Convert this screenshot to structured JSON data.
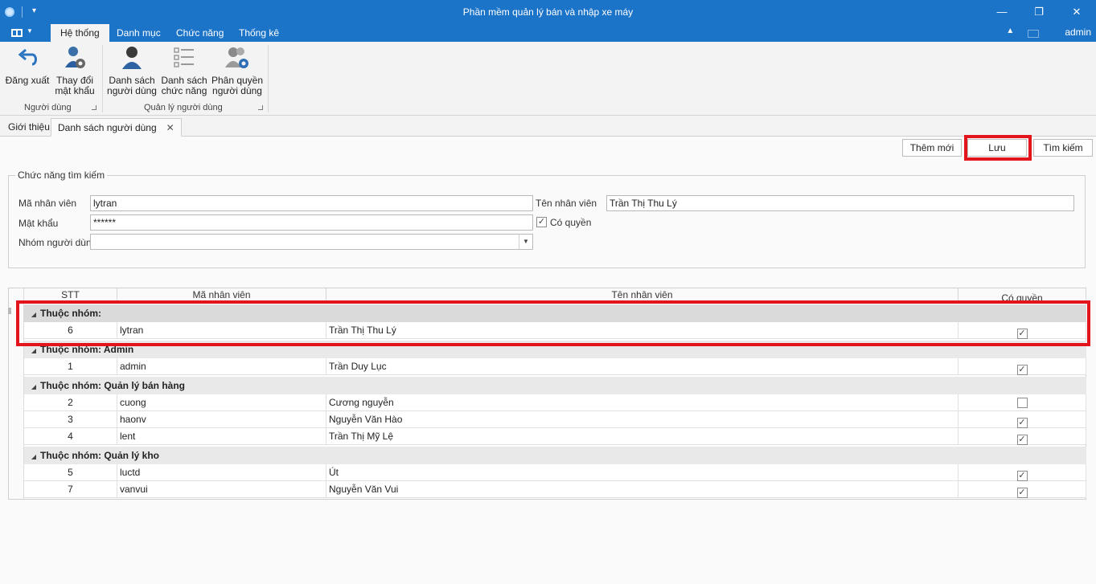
{
  "window": {
    "title": "Phần mềm quản lý bán và nhập xe máy",
    "minimize_glyph": "—",
    "maximize_glyph": "❐",
    "close_glyph": "✕"
  },
  "ribbon": {
    "tabs": [
      "Hệ thống",
      "Danh mục",
      "Chức năng",
      "Thống kê"
    ],
    "active_tab": "Hệ thống",
    "user": "admin",
    "groups": [
      {
        "label": "Người dùng",
        "buttons": [
          {
            "line1": "Đăng xuất",
            "line2": "",
            "icon": "logout-arrow-icon"
          },
          {
            "line1": "Thay đổi",
            "line2": "mật khẩu",
            "icon": "user-gear-icon"
          }
        ]
      },
      {
        "label": "Quản lý người dùng",
        "buttons": [
          {
            "line1": "Danh sách",
            "line2": "người dùng",
            "icon": "user-icon"
          },
          {
            "line1": "Danh sách",
            "line2": "chức năng",
            "icon": "list-icon"
          },
          {
            "line1": "Phân quyền",
            "line2": "người dùng",
            "icon": "users-gear-icon"
          }
        ]
      }
    ]
  },
  "doc_tabs": [
    "Giới thiệu",
    "Danh sách người dùng"
  ],
  "toolbar": {
    "add_label": "Thêm mới",
    "save_label": "Lưu",
    "search_label": "Tìm kiếm"
  },
  "search": {
    "legend": "Chức năng tìm kiếm",
    "employee_id_label": "Mã nhân viên",
    "employee_id_value": "lytran",
    "employee_name_label": "Tên nhân viên",
    "employee_name_value": "Trần Thị Thu Lý",
    "password_label": "Mật khẩu",
    "password_value": "******",
    "has_permission_label": "Có quyền",
    "has_permission_checked": true,
    "user_group_label": "Nhóm người dùng",
    "user_group_value": ""
  },
  "grid": {
    "columns": [
      "STT",
      "Mã nhân viên",
      "Tên nhân viên",
      "Có quyền"
    ],
    "groups": [
      {
        "label": "Thuộc nhóm:",
        "rows": [
          {
            "stt": "6",
            "id": "lytran",
            "name": "Trần Thị Thu Lý",
            "perm": true
          }
        ]
      },
      {
        "label": "Thuộc nhóm: Admin",
        "rows": [
          {
            "stt": "1",
            "id": "admin",
            "name": "Trần Duy Lục",
            "perm": true
          }
        ]
      },
      {
        "label": "Thuộc nhóm: Quản lý bán hàng",
        "rows": [
          {
            "stt": "2",
            "id": "cuong",
            "name": "Cương nguyễn",
            "perm": false
          },
          {
            "stt": "3",
            "id": "haonv",
            "name": "Nguyễn Văn Hào",
            "perm": true
          },
          {
            "stt": "4",
            "id": "lent",
            "name": "Trần Thị Mỹ Lệ",
            "perm": true
          }
        ]
      },
      {
        "label": "Thuộc nhóm: Quản lý kho",
        "rows": [
          {
            "stt": "5",
            "id": "luctd",
            "name": "Út",
            "perm": true
          },
          {
            "stt": "7",
            "id": "vanvui",
            "name": "Nguyễn Văn Vui",
            "perm": true
          }
        ]
      }
    ]
  },
  "colors": {
    "accent": "#1c74c9",
    "highlight": "#e3141b"
  },
  "glyphs": {
    "check": "✓",
    "expand": "◢",
    "dropdown": "▼",
    "close_tab": "✕",
    "collapse_ribbon": "▲"
  }
}
